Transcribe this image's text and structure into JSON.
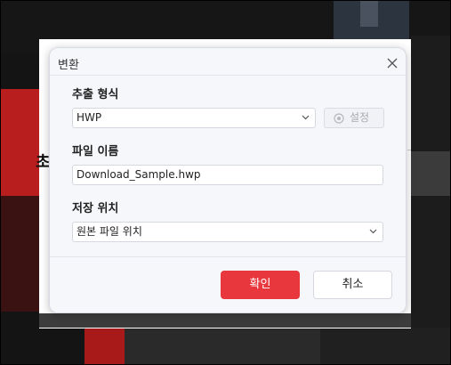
{
  "background": {
    "page_heading_fragment": "초"
  },
  "dialog": {
    "title": "변환",
    "export_format": {
      "label": "추출 형식",
      "value": "HWP",
      "settings_label": "설정"
    },
    "file_name": {
      "label": "파일 이름",
      "value": "Download_Sample.hwp"
    },
    "save_location": {
      "label": "저장 위치",
      "value": "원본 파일 위치"
    },
    "ok_label": "확인",
    "cancel_label": "취소"
  },
  "colors": {
    "accent": "#e8383d",
    "dialog_bg": "#f6f7fa"
  }
}
